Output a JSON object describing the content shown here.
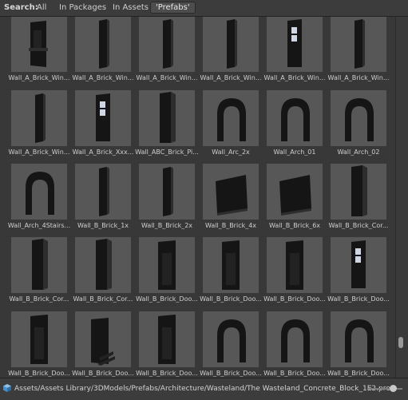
{
  "search": {
    "label": "Search:",
    "tabs": [
      "All",
      "In Packages",
      "In Assets",
      "'Prefabs'"
    ],
    "selected_index": 3
  },
  "assets": [
    "Wall_A_Brick_Win...",
    "Wall_A_Brick_Win...",
    "Wall_A_Brick_Win...",
    "Wall_A_Brick_Win...",
    "Wall_A_Brick_Win...",
    "Wall_A_Brick_Win...",
    "Wall_A_Brick_Win...",
    "Wall_A_Brick_Xxx...",
    "Wall_ABC_Brick_Pi...",
    "Wall_Arc_2x",
    "Wall_Arch_01",
    "Wall_Arch_02",
    "Wall_Arch_4Stairs...",
    "Wall_B_Brick_1x",
    "Wall_B_Brick_2x",
    "Wall_B_Brick_4x",
    "Wall_B_Brick_6x",
    "Wall_B_Brick_Cor...",
    "Wall_B_Brick_Cor...",
    "Wall_B_Brick_Cor...",
    "Wall_B_Brick_Doo...",
    "Wall_B_Brick_Doo...",
    "Wall_B_Brick_Doo...",
    "Wall_B_Brick_Doo...",
    "Wall_B_Brick_Doo...",
    "Wall_B_Brick_Doo...",
    "Wall_B_Brick_Doo...",
    "Wall_B_Brick_Doo...",
    "Wall_B_Brick_Doo...",
    "Wall_B_Brick_Doo..."
  ],
  "status": {
    "path": "Assets/Assets Library/3DModels/Prefabs/Architecture/Wasteland/The Wasteland_Concrete_Block_1E2.pre",
    "prefab_icon": "prefab-cube-icon"
  },
  "scrollbar": {
    "position_fraction": 0.92
  },
  "zoom_slider": {
    "value_fraction": 0.7
  }
}
